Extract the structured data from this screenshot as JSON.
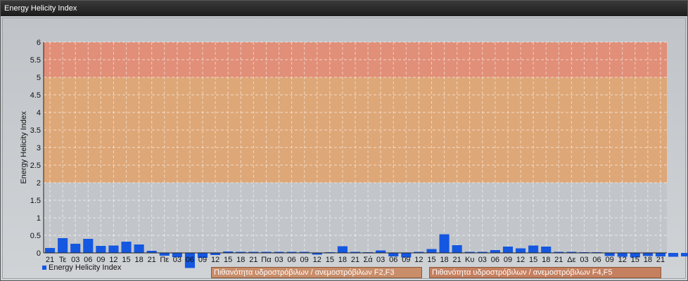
{
  "window": {
    "title": "Energy Helicity Index"
  },
  "legend": {
    "series_label": "Energy Helicity Index"
  },
  "bands": [
    {
      "label": "Πιθανότητα υδροστρόβιλων / ανεμοστρόβιλων F2,F3",
      "from": 2,
      "to": 5,
      "color": "#e1a36e"
    },
    {
      "label": "Πιθανότητα υδροστρόβιλων / ανεμοστρόβιλων F4,F5",
      "from": 5,
      "to": 6,
      "color": "#e4886f"
    }
  ],
  "colors": {
    "bar": "#1457e0",
    "grid": "#ffffff",
    "below_band": "#c2c6cb"
  },
  "chart_data": {
    "type": "bar",
    "ylabel": "Energy Helicity Index",
    "xlabel": "",
    "ylim": [
      0,
      6
    ],
    "yticks": [
      0,
      0.5,
      1,
      1.5,
      2,
      2.5,
      3,
      3.5,
      4,
      4.5,
      5,
      5.5,
      6
    ],
    "grid": true,
    "legend_position": "bottom-left",
    "categories": [
      "21",
      "Τε",
      "03",
      "06",
      "09",
      "12",
      "15",
      "18",
      "21",
      "Πε",
      "03",
      "06",
      "09",
      "12",
      "15",
      "18",
      "21",
      "Πα",
      "03",
      "06",
      "09",
      "12",
      "15",
      "18",
      "21",
      "Σά",
      "03",
      "06",
      "09",
      "12",
      "15",
      "18",
      "21",
      "Κυ",
      "03",
      "06",
      "09",
      "12",
      "15",
      "18",
      "21",
      "Δε",
      "03",
      "06",
      "09",
      "12",
      "15",
      "18",
      "21"
    ],
    "series": [
      {
        "name": "Energy Helicity Index",
        "values": [
          0.14,
          0.42,
          0.26,
          0.4,
          0.2,
          0.21,
          0.32,
          0.24,
          0.06,
          -0.08,
          -0.12,
          -0.43,
          -0.14,
          -0.06,
          0.04,
          0.03,
          0.03,
          0.03,
          0.03,
          0.03,
          0.03,
          -0.05,
          0.02,
          0.19,
          0.03,
          0.02,
          0.07,
          -0.1,
          -0.13,
          0.03,
          0.11,
          0.53,
          0.22,
          0.03,
          0.03,
          0.08,
          0.18,
          0.13,
          0.21,
          0.18,
          0.03,
          0.03,
          0.02,
          0.02,
          -0.09,
          -0.11,
          -0.13,
          -0.09,
          -0.1,
          -0.11,
          -0.1
        ]
      }
    ]
  }
}
